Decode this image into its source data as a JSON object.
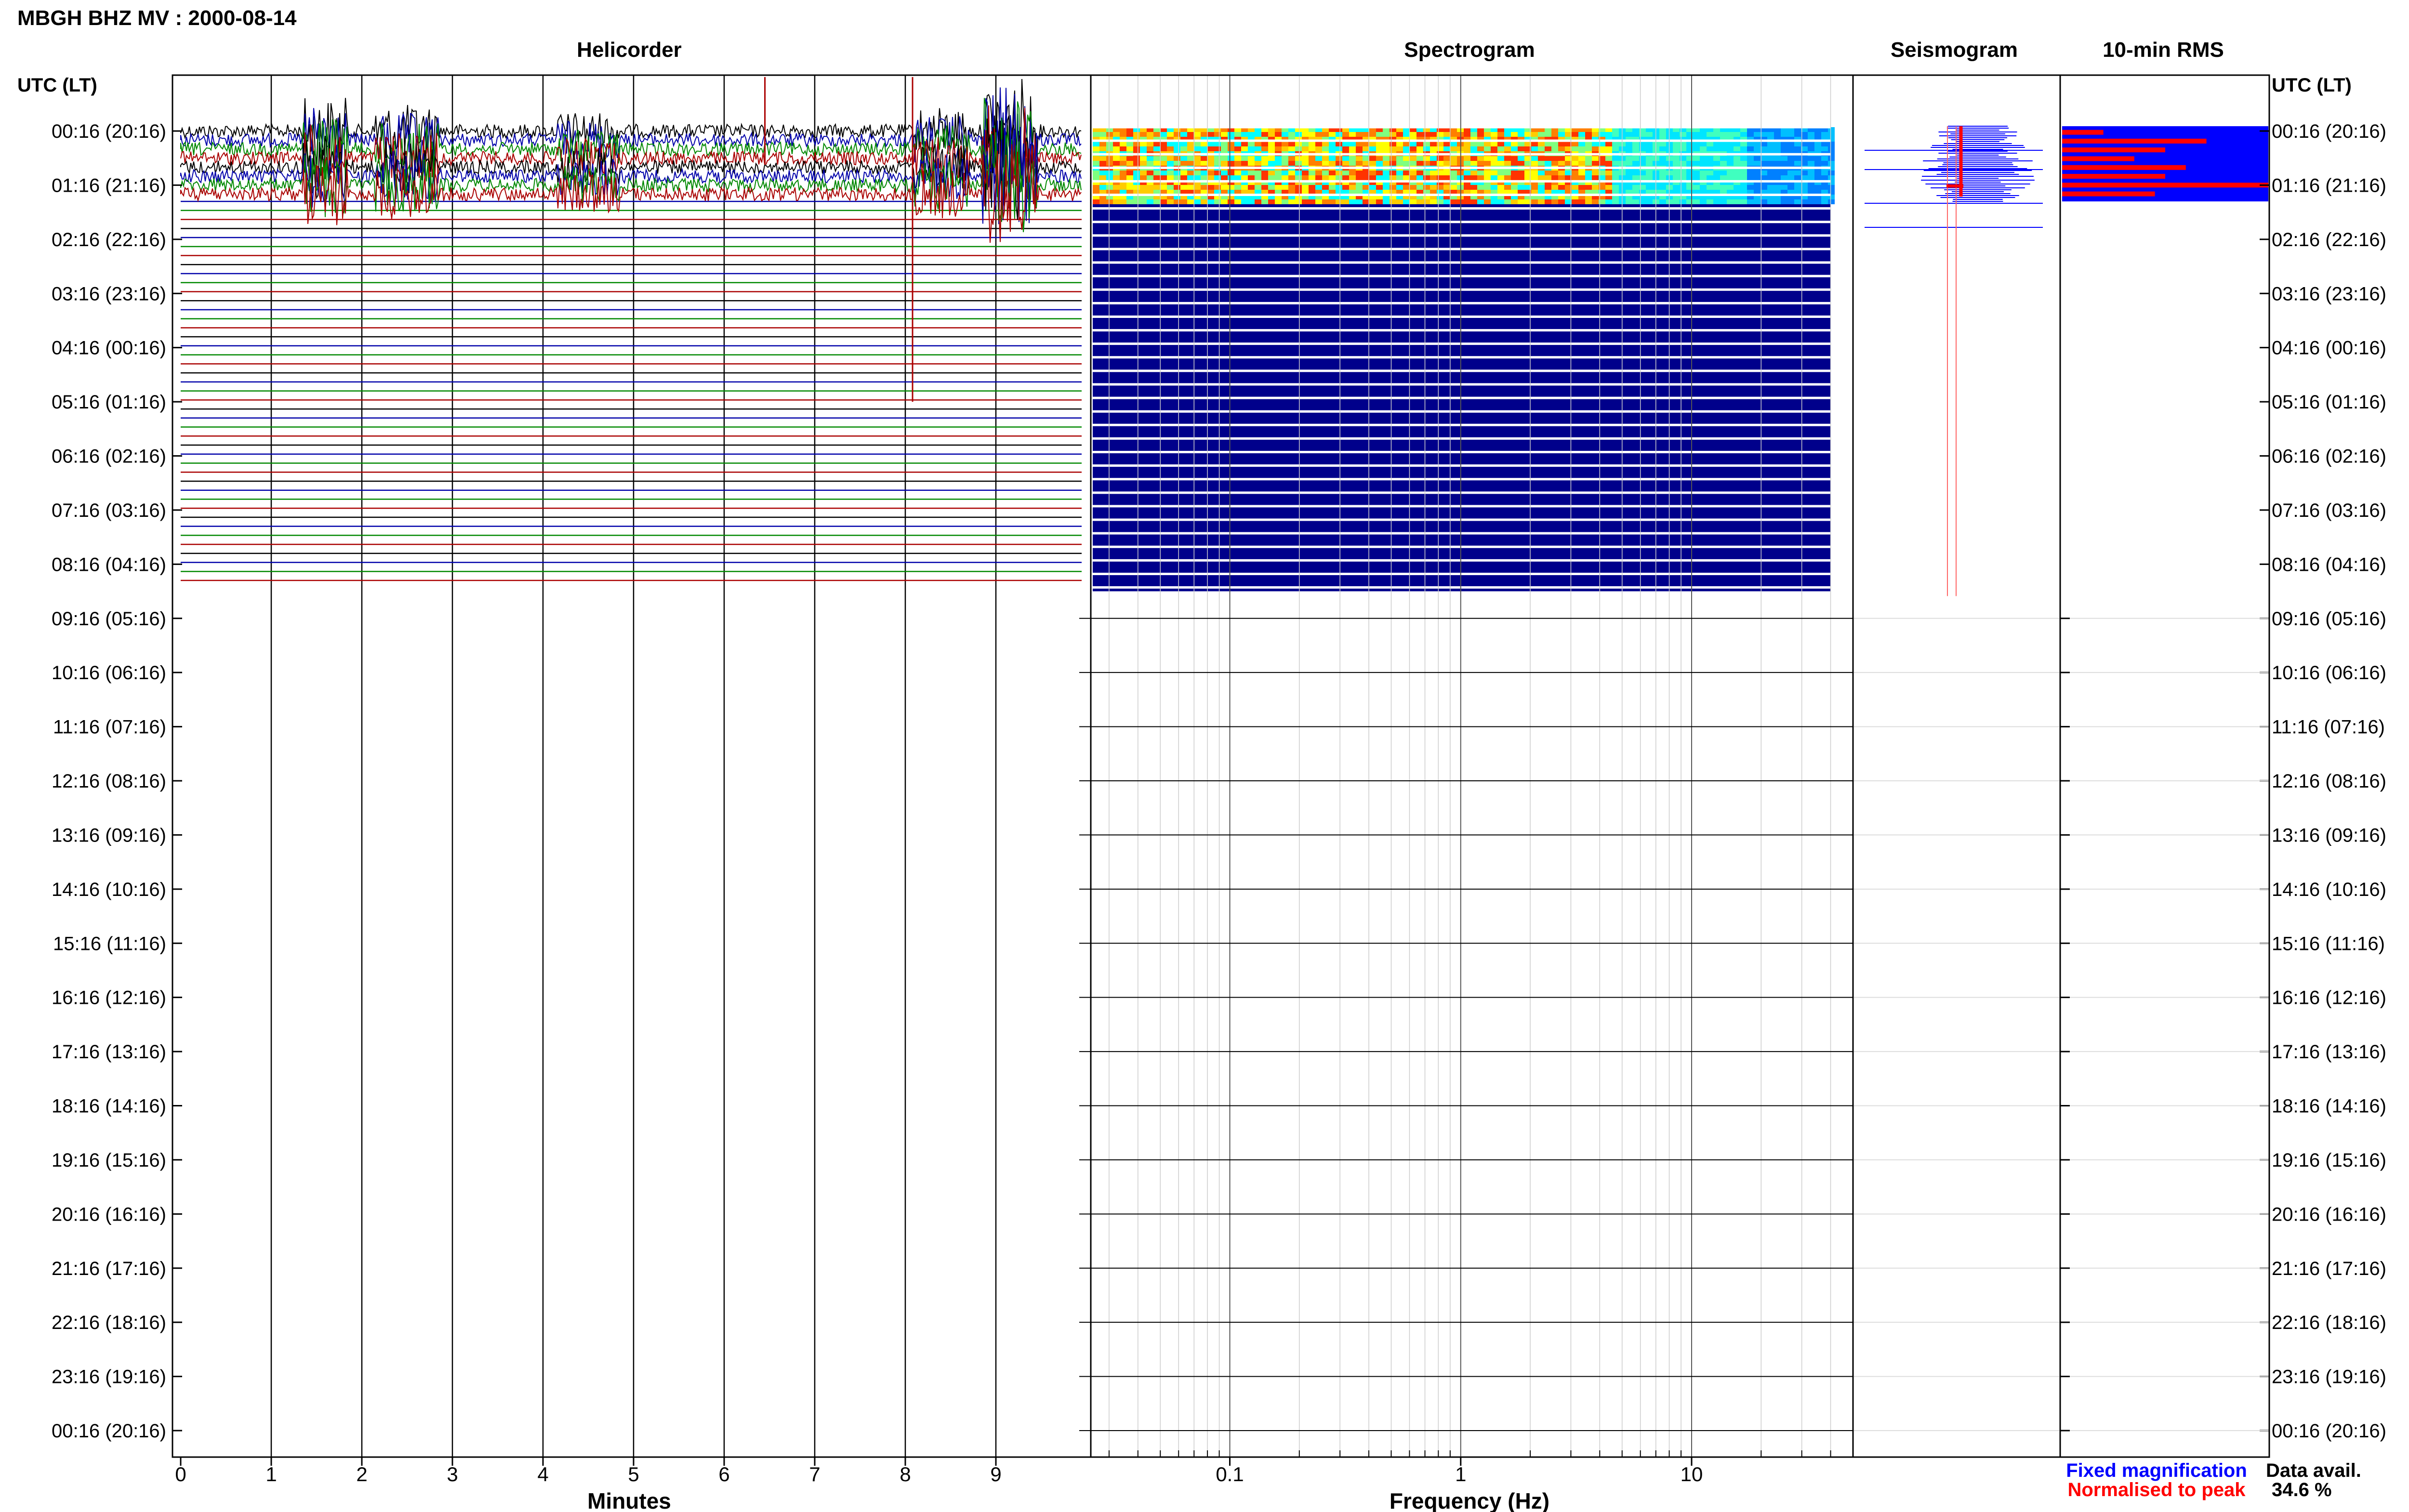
{
  "title": "MBGH BHZ MV : 2000-08-14",
  "colors": {
    "fixed": "#0000ff",
    "normalised": "#ff0000",
    "heli_traces": [
      "#000000",
      "#0000aa",
      "#008800",
      "#aa0000"
    ],
    "spec_background": "#00008b"
  },
  "chart_data": [
    {
      "type": "line",
      "name": "helicorder",
      "title": "Helicorder",
      "xlabel": "Minutes",
      "ylabel": "UTC (LT)",
      "ylabel_right": "UTC (LT)",
      "x_ticks": [
        0,
        1,
        2,
        3,
        4,
        5,
        6,
        7,
        8,
        9
      ],
      "xlim": [
        0,
        10
      ],
      "y_ticks_utc": [
        "00:16",
        "01:16",
        "02:16",
        "03:16",
        "04:16",
        "05:16",
        "06:16",
        "07:16",
        "08:16",
        "09:16",
        "10:16",
        "11:16",
        "12:16",
        "13:16",
        "14:16",
        "15:16",
        "16:16",
        "17:16",
        "18:16",
        "19:16",
        "20:16",
        "21:16",
        "22:16",
        "23:16",
        "00:16"
      ],
      "y_ticks_lt": [
        "20:16",
        "21:16",
        "22:16",
        "23:16",
        "00:16",
        "01:16",
        "02:16",
        "03:16",
        "04:16",
        "05:16",
        "06:16",
        "07:16",
        "08:16",
        "09:16",
        "10:16",
        "11:16",
        "12:16",
        "13:16",
        "14:16",
        "15:16",
        "16:16",
        "17:16",
        "18:16",
        "19:16",
        "20:16"
      ],
      "active_hours": [
        0.0,
        1.3
      ],
      "flat_hours": [
        1.3,
        8.5
      ],
      "spikes": [
        {
          "minute": 8.08,
          "hour_bottom": 5.0
        },
        {
          "minute": 6.45,
          "hour_bottom": 0.6
        }
      ]
    },
    {
      "type": "heatmap",
      "name": "spectrogram",
      "title": "Spectrogram",
      "xlabel": "Frequency (Hz)",
      "x_scale": "log",
      "x_ticks": [
        0.1,
        1,
        10
      ],
      "xlim": [
        0.025,
        50
      ],
      "frequency_max": 40,
      "active_hours": [
        0.0,
        1.3
      ],
      "data_hours": [
        0.0,
        8.5
      ]
    },
    {
      "type": "line",
      "name": "seismogram",
      "title": "Seismogram",
      "legend": [
        "Fixed magnification",
        "Normalised to peak"
      ]
    },
    {
      "type": "bar",
      "name": "rms",
      "title": "10-min RMS",
      "blue_values_hours": [
        0.0,
        1.3
      ],
      "red_values": [
        0.2,
        0.7,
        0.5,
        0.35,
        0.6,
        0.5,
        1.0,
        0.45
      ]
    }
  ],
  "data_availability": {
    "label": "Data avail.",
    "value": "34.6 %"
  }
}
